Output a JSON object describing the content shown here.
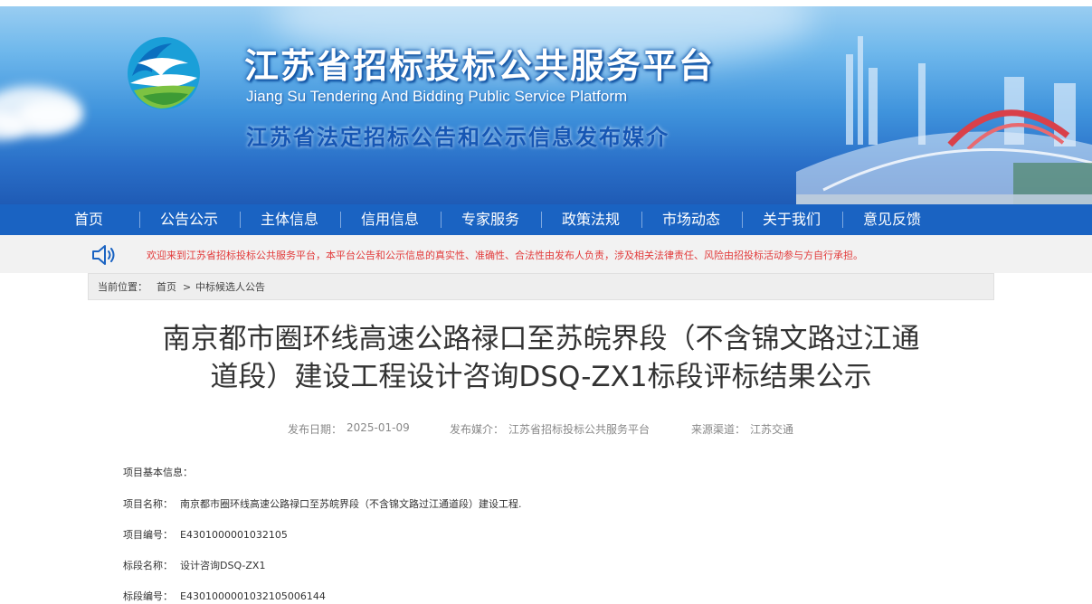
{
  "header": {
    "title_cn": "江苏省招标投标公共服务平台",
    "title_en": "Jiang Su Tendering And Bidding Public Service Platform",
    "subtitle": "江苏省法定招标公告和公示信息发布媒介",
    "logo_icon": "platform-logo-icon"
  },
  "nav": {
    "items": [
      "首页",
      "公告公示",
      "主体信息",
      "信用信息",
      "专家服务",
      "政策法规",
      "市场动态",
      "关于我们",
      "意见反馈"
    ]
  },
  "notice": {
    "icon": "speaker-icon",
    "text": "欢迎来到江苏省招标投标公共服务平台，本平台公告和公示信息的真实性、准确性、合法性由发布人负责，涉及相关法律责任、风险由招投标活动参与方自行承担。"
  },
  "breadcrumb": {
    "label": "当前位置：",
    "home": "首页",
    "sep": ">",
    "current": "中标候选人公告"
  },
  "article": {
    "title_line1": "南京都市圈环线高速公路禄口至苏皖界段（不含锦文路过江通",
    "title_line2": "道段）建设工程设计咨询DSQ-ZX1标段评标结果公示",
    "meta": {
      "date_label": "发布日期：",
      "date": "2025-01-09",
      "media_label": "发布媒介：",
      "media": "江苏省招标投标公共服务平台",
      "source_label": "来源渠道：",
      "source": "江苏交通"
    },
    "info_header": "项目基本信息：",
    "fields": [
      {
        "label": "项目名称：",
        "value": "南京都市圈环线高速公路禄口至苏皖界段（不含锦文路过江通道段）建设工程."
      },
      {
        "label": "项目编号：",
        "value": "E4301000001032105"
      },
      {
        "label": "标段名称：",
        "value": "设计咨询DSQ-ZX1"
      },
      {
        "label": "标段编号：",
        "value": "E4301000001032105006144"
      }
    ]
  },
  "colors": {
    "nav_bg": "#1a63c2",
    "notice_text": "#e23b3b",
    "subtitle": "#1656b4"
  }
}
